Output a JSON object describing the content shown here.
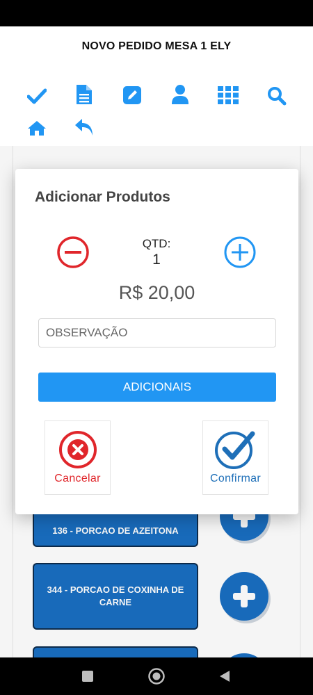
{
  "header": {
    "title": "NOVO PEDIDO MESA 1 ELY"
  },
  "toolbar": {
    "icons": [
      "check-icon",
      "document-icon",
      "edit-icon",
      "user-icon",
      "grid-icon",
      "search-icon",
      "home-icon",
      "back-icon"
    ]
  },
  "products": [
    {
      "label": "136 - PORCAO DE AZEITONA"
    },
    {
      "label": "344 - PORCAO DE COXINHA DE CARNE"
    }
  ],
  "modal": {
    "title": "Adicionar Produtos",
    "qty_label": "QTD:",
    "qty_value": "1",
    "price": "R$ 20,00",
    "observation_placeholder": "OBSERVAÇÃO",
    "addons_label": "ADICIONAIS",
    "cancel_label": "Cancelar",
    "confirm_label": "Confirmar"
  },
  "colors": {
    "accent": "#2196f3",
    "product_card": "#1a6fc2",
    "cancel": "#e0262b",
    "confirm": "#1e6fb8"
  }
}
